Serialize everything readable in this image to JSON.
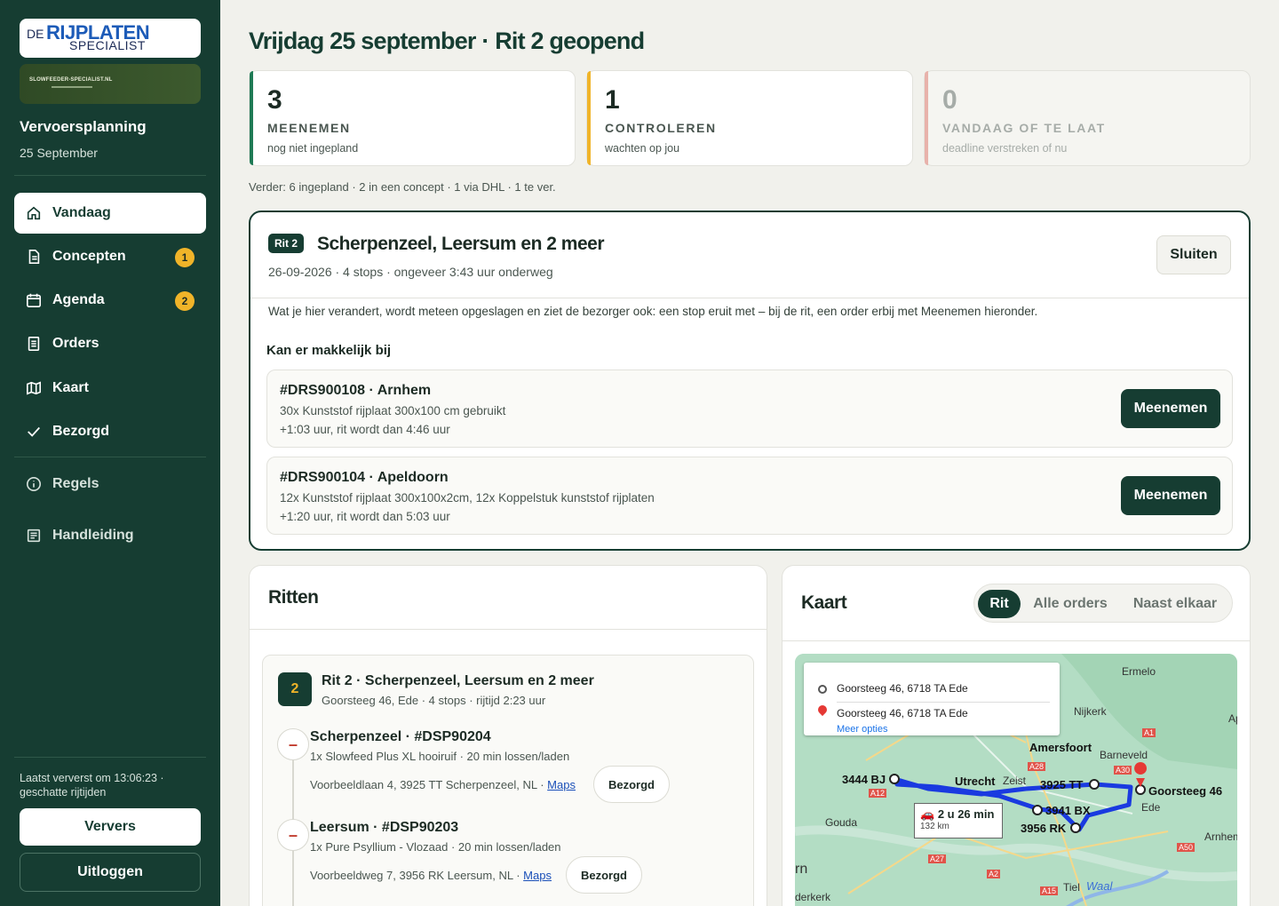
{
  "brand": {
    "de": "DE",
    "rij": "RIJPLATEN",
    "spec": "SPECIALIST",
    "banner": "SLOWFEEDER-SPECIALIST.NL"
  },
  "sidebar": {
    "title": "Vervoersplanning",
    "date": "25 September",
    "items": [
      {
        "label": "Vandaag",
        "icon": "home-icon",
        "active": true
      },
      {
        "label": "Concepten",
        "icon": "document-icon",
        "badge": "1"
      },
      {
        "label": "Agenda",
        "icon": "calendar-icon",
        "badge": "2"
      },
      {
        "label": "Orders",
        "icon": "list-icon"
      },
      {
        "label": "Kaart",
        "icon": "map-icon"
      },
      {
        "label": "Bezorgd",
        "icon": "check-icon"
      },
      {
        "label": "Regels",
        "icon": "info-icon"
      },
      {
        "label": "Handleiding",
        "icon": "manual-icon"
      }
    ],
    "footer": "Laatst ververst om 13:06:23 · geschatte rijtijden",
    "refresh": "Ververs",
    "logout": "Uitloggen"
  },
  "header": {
    "title": "Vrijdag 25 september · Rit 2 geopend"
  },
  "stats": [
    {
      "num": "3",
      "label": "MEENEMEN",
      "sub": "nog niet ingepland",
      "color": "#1f7a55"
    },
    {
      "num": "1",
      "label": "CONTROLEREN",
      "sub": "wachten op jou",
      "color": "#f0b429"
    },
    {
      "num": "0",
      "label": "VANDAAG OF TE LAAT",
      "sub": "deadline verstreken of nu",
      "color": "#e8b2ab"
    }
  ],
  "further": "Verder: 6 ingepland · 2 in een concept · 1 via DHL · 1 te ver.",
  "rit": {
    "pill": "Rit 2",
    "name": "Scherpenzeel, Leersum en 2 meer",
    "meta": "26-09-2026 · 4 stops · ongeveer 3:43 uur onderweg",
    "close": "Sluiten",
    "info": "Wat je hier verandert, wordt meteen opgeslagen en ziet de bezorger ook: een stop eruit met – bij de rit, een order erbij met Meenemen hieronder.",
    "subtitle": "Kan er makkelijk bij",
    "candidates": [
      {
        "title": "#DRS900108 · Arnhem",
        "desc": "30x Kunststof rijplaat 300x100 cm gebruikt",
        "extra": "+1:03 uur, rit wordt dan 4:46 uur",
        "button": "Meenemen"
      },
      {
        "title": "#DRS900104 · Apeldoorn",
        "desc": "12x Kunststof rijplaat 300x100x2cm, 12x Koppelstuk kunststof rijplaten",
        "extra": "+1:20 uur, rit wordt dan 5:03 uur",
        "button": "Meenemen"
      }
    ]
  },
  "ritten": {
    "title": "Ritten",
    "route": {
      "num": "2",
      "title": "Rit 2 · Scherpenzeel, Leersum en 2 meer",
      "meta": "Goorsteeg 46, Ede · 4 stops · rijtijd 2:23 uur",
      "stops": [
        {
          "title": "Scherpenzeel · #DSP90204",
          "sub": "1x Slowfeed Plus XL hooiruif · 20 min lossen/laden",
          "addr": "Voorbeeldlaan 4, 3925 TT Scherpenzeel, NL · ",
          "maps": "Maps",
          "button": "Bezorgd",
          "mark": "–"
        },
        {
          "title": "Leersum · #DSP90203",
          "sub": "1x Pure Psyllium - Vlozaad · 20 min lossen/laden",
          "addr": "Voorbeeldweg 7, 3956 RK Leersum, NL · ",
          "maps": "Maps",
          "button": "Bezorgd",
          "mark": "–"
        }
      ]
    }
  },
  "kaart": {
    "title": "Kaart",
    "tabs": [
      {
        "label": "Rit",
        "active": true
      },
      {
        "label": "Alle orders"
      },
      {
        "label": "Naast elkaar"
      }
    ],
    "from": "Goorsteeg 46, 6718 TA Ede",
    "to": "Goorsteeg 46, 6718 TA Ede",
    "more": "Meer opties",
    "duration": "2 u 26 min",
    "distance": "132 km",
    "labels": [
      "Ermelo",
      "Nijkerk",
      "Amersfoort",
      "Barneveld",
      "Utrecht",
      "Zeist",
      "Gouda",
      "Ede",
      "Arnhem",
      "Tiel",
      "Waal",
      "3444 BJ",
      "3925 TT",
      "3941 BX",
      "3956 RK",
      "Goorsteeg 46",
      "Ap",
      "rn",
      "derkerk"
    ],
    "roads": [
      "A1",
      "A28",
      "A30",
      "A12",
      "A27",
      "A2",
      "A50",
      "A15"
    ],
    "route_color": "#1a3ae0"
  }
}
